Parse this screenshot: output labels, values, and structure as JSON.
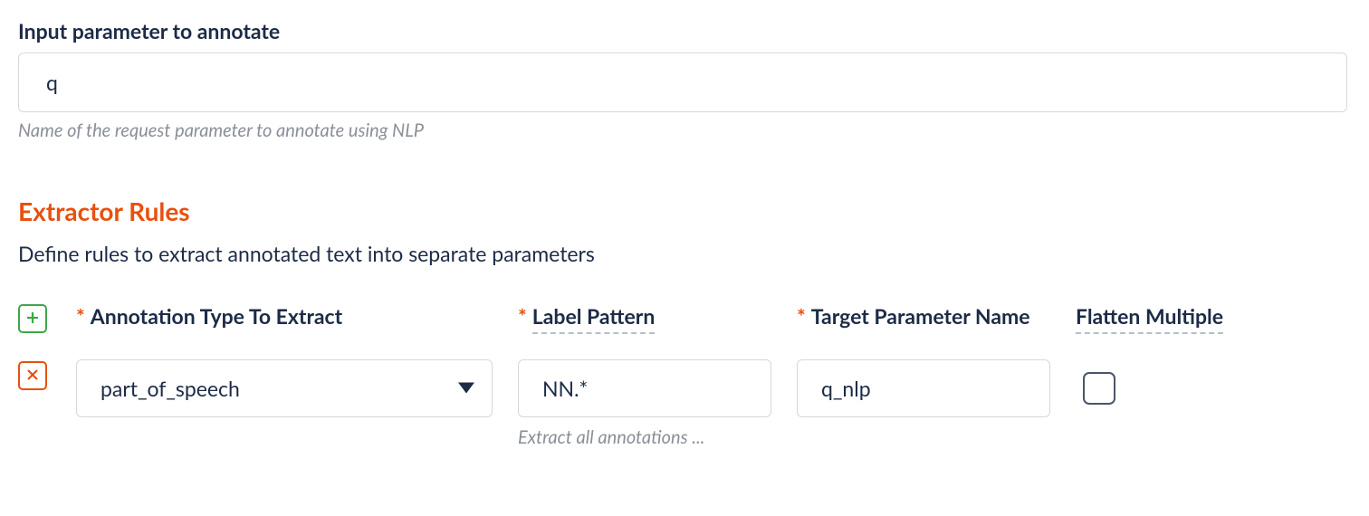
{
  "input_param": {
    "label": "Input parameter to annotate",
    "value": "q",
    "help": "Name of the request parameter to annotate using NLP"
  },
  "extractor": {
    "heading": "Extractor Rules",
    "description": "Define rules to extract annotated text into separate parameters",
    "headers": {
      "annotation_type": "Annotation Type To Extract",
      "label_pattern": "Label Pattern",
      "target_param": "Target Parameter Name",
      "flatten": "Flatten Multiple"
    },
    "rows": [
      {
        "annotation_type": "part_of_speech",
        "label_pattern": "NN.*",
        "label_pattern_help": "Extract all annotations ...",
        "target_param": "q_nlp",
        "flatten": false
      }
    ]
  }
}
